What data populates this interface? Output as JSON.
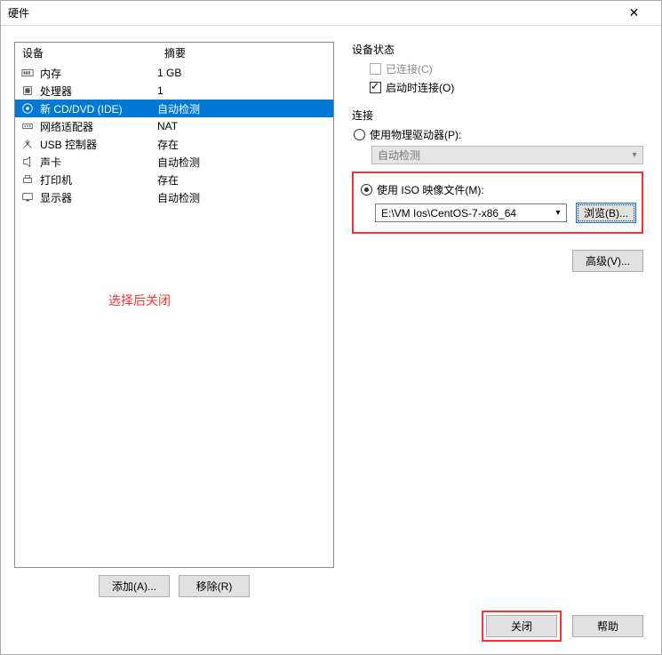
{
  "title": "硬件",
  "device_table": {
    "header_device": "设备",
    "header_summary": "摘要",
    "rows": [
      {
        "name": "内存",
        "summary": "1 GB"
      },
      {
        "name": "处理器",
        "summary": "1"
      },
      {
        "name": "新 CD/DVD (IDE)",
        "summary": "自动检测"
      },
      {
        "name": "网络适配器",
        "summary": "NAT"
      },
      {
        "name": "USB 控制器",
        "summary": "存在"
      },
      {
        "name": "声卡",
        "summary": "自动检测"
      },
      {
        "name": "打印机",
        "summary": "存在"
      },
      {
        "name": "显示器",
        "summary": "自动检测"
      }
    ],
    "selected_index": 2
  },
  "annotation": "选择后关闭",
  "left_buttons": {
    "add": "添加(A)...",
    "remove": "移除(R)"
  },
  "right": {
    "status_label": "设备状态",
    "connected": "已连接(C)",
    "connect_on_start": "启动时连接(O)",
    "connection_label": "连接",
    "use_physical": "使用物理驱动器(P):",
    "physical_value": "自动检测",
    "use_iso": "使用 ISO 映像文件(M):",
    "iso_value": "E:\\VM Ios\\CentOS-7-x86_64",
    "browse": "浏览(B)...",
    "advanced": "高级(V)..."
  },
  "footer": {
    "close": "关闭",
    "help": "帮助"
  }
}
